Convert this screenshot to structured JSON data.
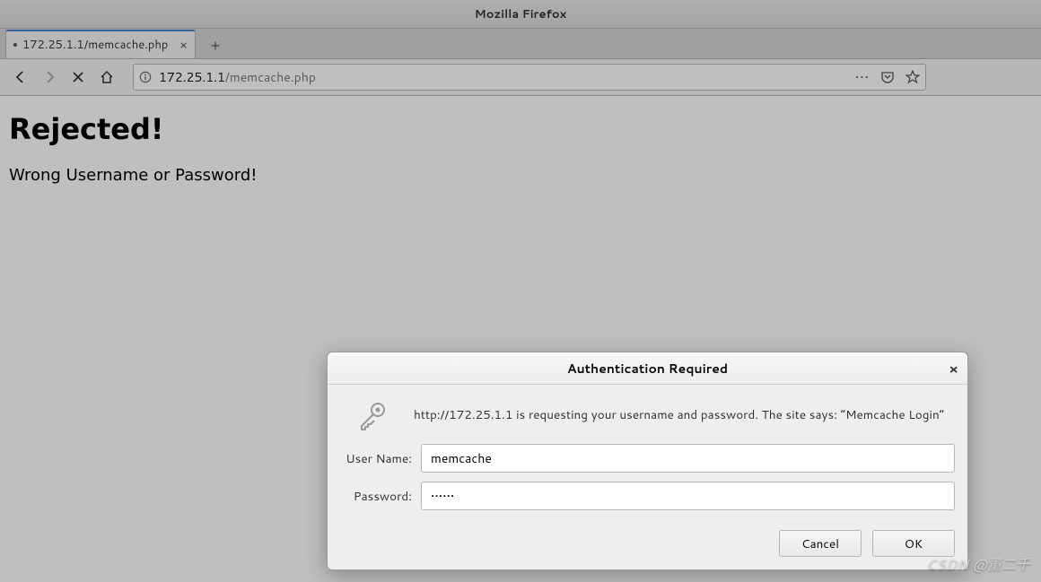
{
  "window": {
    "title": "Mozilla Firefox"
  },
  "tab": {
    "title": "172.25.1.1/memcache.php"
  },
  "url": {
    "host": "172.25.1.1",
    "path": "/memcache.php"
  },
  "page": {
    "heading": "Rejected!",
    "message": "Wrong Username or Password!"
  },
  "dialog": {
    "title": "Authentication Required",
    "message": "http://172.25.1.1 is requesting your username and password. The site says: “Memcache Login”",
    "username_label": "User Name:",
    "username_value": "memcache",
    "password_label": "Password:",
    "password_value": "••••••",
    "cancel": "Cancel",
    "ok": "OK"
  },
  "watermark": "CSDN @董二千"
}
